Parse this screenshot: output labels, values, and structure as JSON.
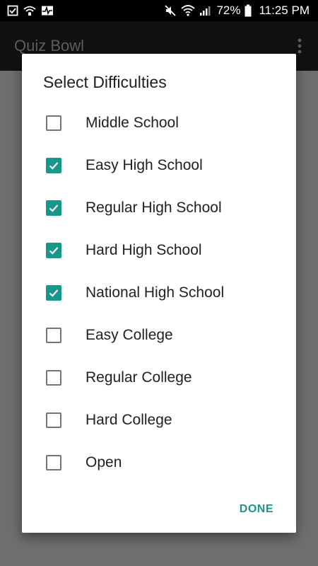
{
  "status_bar": {
    "left_icons": [
      "task-check-icon",
      "wifi-call-icon",
      "pulse-monitor-icon"
    ],
    "right_icons": [
      "mute-icon",
      "wifi-icon",
      "signal-icon",
      "battery-icon"
    ],
    "battery": "72%",
    "time": "11:25 PM"
  },
  "app_bar": {
    "title": "Quiz Bowl",
    "menu_icon": "overflow-menu-icon"
  },
  "dialog": {
    "title": "Select Difficulties",
    "options": [
      {
        "label": "Middle School",
        "checked": false
      },
      {
        "label": "Easy High School",
        "checked": true
      },
      {
        "label": "Regular High School",
        "checked": true
      },
      {
        "label": "Hard High School",
        "checked": true
      },
      {
        "label": "National High School",
        "checked": true
      },
      {
        "label": "Easy College",
        "checked": false
      },
      {
        "label": "Regular College",
        "checked": false
      },
      {
        "label": "Hard College",
        "checked": false
      },
      {
        "label": "Open",
        "checked": false
      }
    ],
    "done_label": "DONE"
  },
  "colors": {
    "accent": "#16978a",
    "scrim": "#6f6f6f",
    "status_bar": "#000000"
  }
}
